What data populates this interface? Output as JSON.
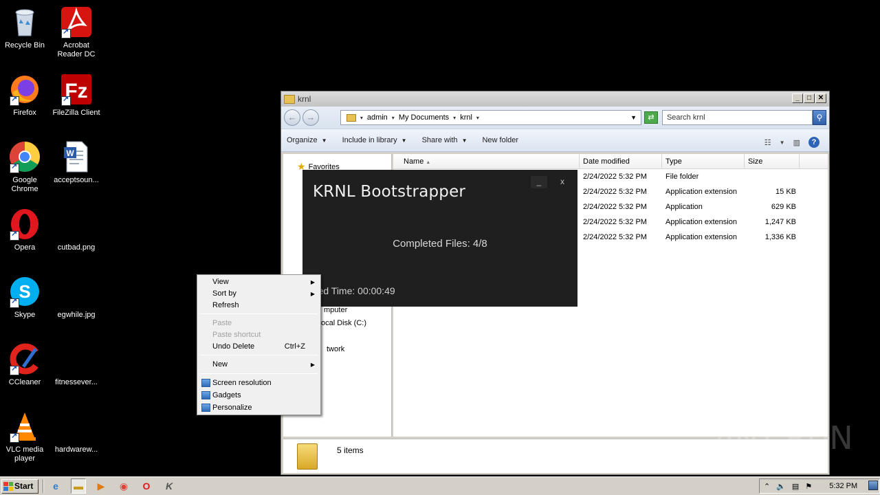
{
  "desktop": {
    "icons": [
      {
        "label": "Recycle Bin",
        "icon": "recycle-bin-icon"
      },
      {
        "label": "Acrobat Reader DC",
        "icon": "acrobat-icon"
      },
      {
        "label": "Firefox",
        "icon": "firefox-icon"
      },
      {
        "label": "FileZilla Client",
        "icon": "filezilla-icon"
      },
      {
        "label": "Google Chrome",
        "icon": "chrome-icon"
      },
      {
        "label": "acceptsoun...",
        "icon": "word-document-icon"
      },
      {
        "label": "Opera",
        "icon": "opera-icon"
      },
      {
        "label": "cutbad.png",
        "icon": "image-file-icon"
      },
      {
        "label": "Skype",
        "icon": "skype-icon"
      },
      {
        "label": "egwhile.jpg",
        "icon": "image-file-icon"
      },
      {
        "label": "CCleaner",
        "icon": "ccleaner-icon"
      },
      {
        "label": "fitnessever...",
        "icon": "file-icon"
      },
      {
        "label": "VLC media player",
        "icon": "vlc-icon"
      },
      {
        "label": "hardwarew...",
        "icon": "file-icon"
      }
    ]
  },
  "explorer": {
    "title": "krnl",
    "breadcrumb": [
      "admin",
      "My Documents",
      "krnl"
    ],
    "search_placeholder": "Search krnl",
    "toolbar": {
      "organize": "Organize",
      "include_in_library": "Include in library",
      "share_with": "Share with",
      "new_folder": "New folder"
    },
    "nav": {
      "favorites": "Favorites",
      "computer": "mputer",
      "local_disk": "ocal Disk (C:)",
      "network": "twork"
    },
    "columns": {
      "name": "Name",
      "date": "Date modified",
      "type": "Type",
      "size": "Size"
    },
    "rows": [
      {
        "date": "2/24/2022 5:32 PM",
        "type": "File folder",
        "size": ""
      },
      {
        "date": "2/24/2022 5:32 PM",
        "type": "Application extension",
        "size": "15 KB"
      },
      {
        "date": "2/24/2022 5:32 PM",
        "type": "Application",
        "size": "629 KB"
      },
      {
        "date": "2/24/2022 5:32 PM",
        "type": "Application extension",
        "size": "1,247 KB"
      },
      {
        "date": "2/24/2022 5:32 PM",
        "type": "Application extension",
        "size": "1,336 KB"
      }
    ],
    "status": "5 items"
  },
  "krnl": {
    "title": "KRNL Bootstrapper",
    "minimize": "_",
    "close": "x",
    "progress": "Completed Files: 4/8",
    "elapsed": "apsed Time: 00:00:49"
  },
  "context_menu": {
    "view": "View",
    "sort_by": "Sort by",
    "refresh": "Refresh",
    "paste": "Paste",
    "paste_shortcut": "Paste shortcut",
    "undo_delete": "Undo Delete",
    "undo_shortcut": "Ctrl+Z",
    "new": "New",
    "screen_resolution": "Screen resolution",
    "gadgets": "Gadgets",
    "personalize": "Personalize"
  },
  "taskbar": {
    "start": "Start",
    "clock": "5:32 PM"
  },
  "watermark": "ANY RUN"
}
